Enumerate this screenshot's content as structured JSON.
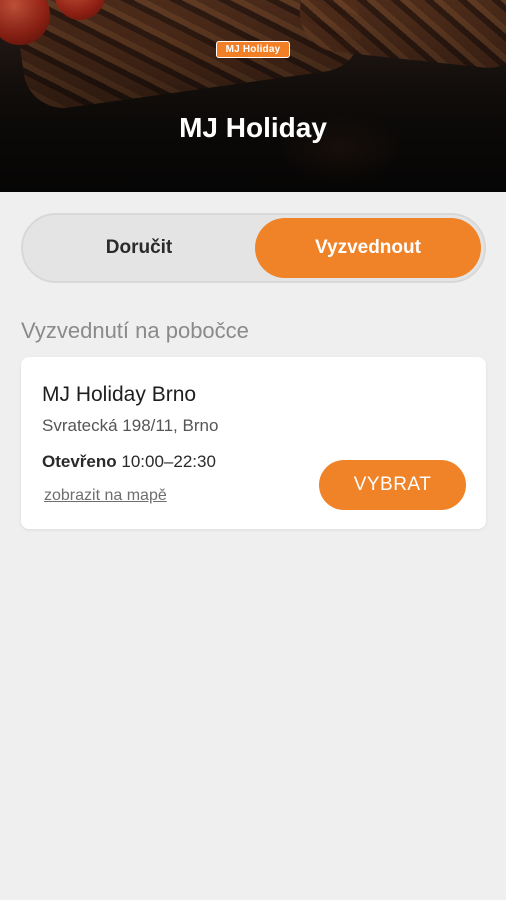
{
  "header": {
    "logo_text": "MJ Holiday",
    "title": "MJ Holiday"
  },
  "mode_toggle": {
    "options": [
      {
        "label": "Doručit",
        "selected": false
      },
      {
        "label": "Vyzvednout",
        "selected": true
      }
    ]
  },
  "pickup": {
    "section_label": "Vyzvednutí na pobočce",
    "branches": [
      {
        "name": "MJ Holiday Brno",
        "address": "Svratecká 198/11, Brno",
        "hours_label": "Otevřeno",
        "hours": "10:00–22:30",
        "map_link": "zobrazit na mapě",
        "select_label": "VYBRAT"
      }
    ]
  },
  "colors": {
    "accent": "#f08228",
    "background": "#efefef",
    "card": "#ffffff"
  }
}
